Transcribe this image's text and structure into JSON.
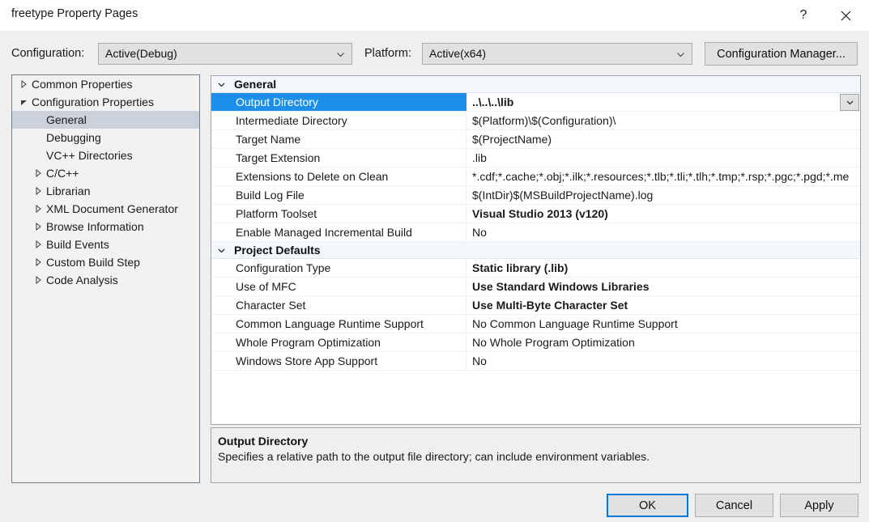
{
  "window": {
    "title": "freetype Property Pages",
    "help_icon": "question-mark-icon",
    "close_icon": "close-icon"
  },
  "toolbar": {
    "configuration_label": "Configuration:",
    "configuration_value": "Active(Debug)",
    "platform_label": "Platform:",
    "platform_value": "Active(x64)",
    "configuration_manager_label": "Configuration Manager..."
  },
  "tree": {
    "items": [
      {
        "label": "Common Properties",
        "indent": 0,
        "arrow": "collapsed",
        "selected": false
      },
      {
        "label": "Configuration Properties",
        "indent": 0,
        "arrow": "expanded",
        "selected": false
      },
      {
        "label": "General",
        "indent": 1,
        "arrow": "none",
        "selected": true
      },
      {
        "label": "Debugging",
        "indent": 1,
        "arrow": "none",
        "selected": false
      },
      {
        "label": "VC++ Directories",
        "indent": 1,
        "arrow": "none",
        "selected": false
      },
      {
        "label": "C/C++",
        "indent": 1,
        "arrow": "collapsed",
        "selected": false
      },
      {
        "label": "Librarian",
        "indent": 1,
        "arrow": "collapsed",
        "selected": false
      },
      {
        "label": "XML Document Generator",
        "indent": 1,
        "arrow": "collapsed",
        "selected": false
      },
      {
        "label": "Browse Information",
        "indent": 1,
        "arrow": "collapsed",
        "selected": false
      },
      {
        "label": "Build Events",
        "indent": 1,
        "arrow": "collapsed",
        "selected": false
      },
      {
        "label": "Custom Build Step",
        "indent": 1,
        "arrow": "collapsed",
        "selected": false
      },
      {
        "label": "Code Analysis",
        "indent": 1,
        "arrow": "collapsed",
        "selected": false
      }
    ]
  },
  "grid": {
    "sections": [
      {
        "title": "General",
        "expanded": true,
        "rows": [
          {
            "name": "Output Directory",
            "value": "..\\..\\..\\lib",
            "bold": true,
            "selected": true,
            "dropdown": true
          },
          {
            "name": "Intermediate Directory",
            "value": "$(Platform)\\$(Configuration)\\",
            "bold": false,
            "selected": false,
            "dropdown": false
          },
          {
            "name": "Target Name",
            "value": "$(ProjectName)",
            "bold": false,
            "selected": false,
            "dropdown": false
          },
          {
            "name": "Target Extension",
            "value": ".lib",
            "bold": false,
            "selected": false,
            "dropdown": false
          },
          {
            "name": "Extensions to Delete on Clean",
            "value": "*.cdf;*.cache;*.obj;*.ilk;*.resources;*.tlb;*.tli;*.tlh;*.tmp;*.rsp;*.pgc;*.pgd;*.me",
            "bold": false,
            "selected": false,
            "dropdown": false
          },
          {
            "name": "Build Log File",
            "value": "$(IntDir)$(MSBuildProjectName).log",
            "bold": false,
            "selected": false,
            "dropdown": false
          },
          {
            "name": "Platform Toolset",
            "value": "Visual Studio 2013 (v120)",
            "bold": true,
            "selected": false,
            "dropdown": false
          },
          {
            "name": "Enable Managed Incremental Build",
            "value": "No",
            "bold": false,
            "selected": false,
            "dropdown": false
          }
        ]
      },
      {
        "title": "Project Defaults",
        "expanded": true,
        "rows": [
          {
            "name": "Configuration Type",
            "value": "Static library (.lib)",
            "bold": true,
            "selected": false,
            "dropdown": false
          },
          {
            "name": "Use of MFC",
            "value": "Use Standard Windows Libraries",
            "bold": true,
            "selected": false,
            "dropdown": false
          },
          {
            "name": "Character Set",
            "value": "Use Multi-Byte Character Set",
            "bold": true,
            "selected": false,
            "dropdown": false
          },
          {
            "name": "Common Language Runtime Support",
            "value": "No Common Language Runtime Support",
            "bold": false,
            "selected": false,
            "dropdown": false
          },
          {
            "name": "Whole Program Optimization",
            "value": "No Whole Program Optimization",
            "bold": false,
            "selected": false,
            "dropdown": false
          },
          {
            "name": "Windows Store App Support",
            "value": "No",
            "bold": false,
            "selected": false,
            "dropdown": false
          }
        ]
      }
    ]
  },
  "description": {
    "title": "Output Directory",
    "body": "Specifies a relative path to the output file directory; can include environment variables."
  },
  "footer": {
    "ok_label": "OK",
    "cancel_label": "Cancel",
    "apply_label": "Apply"
  },
  "colors": {
    "selection_blue": "#1e8fe8",
    "focus_blue": "#0078d7",
    "tree_selection": "#cbd0dd",
    "section_header": "#f4f8fc",
    "dialog_bg": "#efeff0"
  }
}
